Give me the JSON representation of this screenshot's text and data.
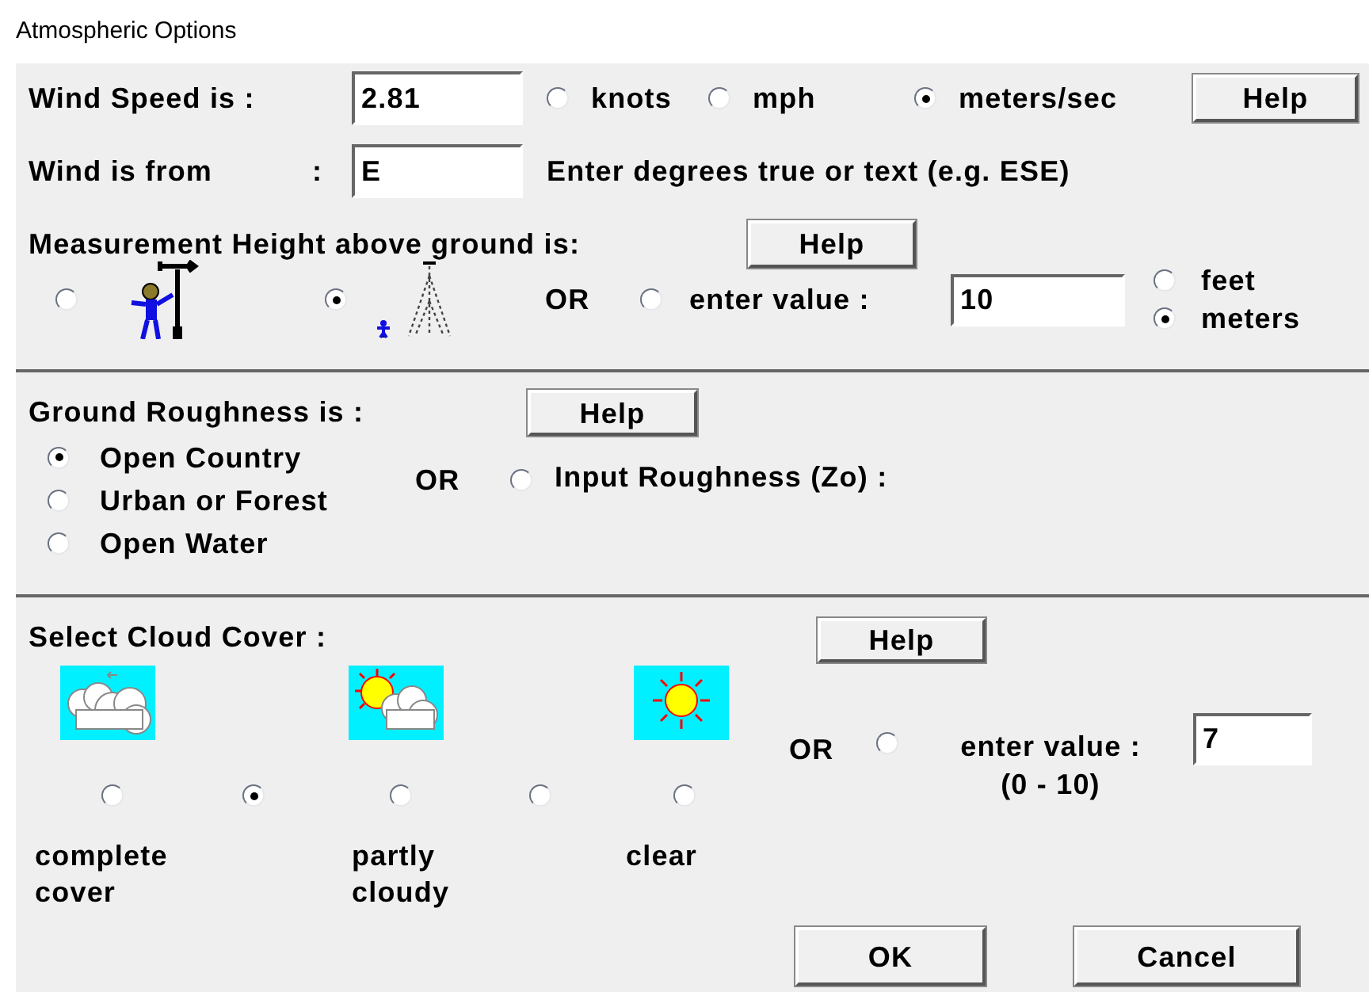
{
  "window": {
    "title": "Atmospheric Options"
  },
  "wind_speed": {
    "label": "Wind Speed is :",
    "value": "2.81",
    "units": [
      {
        "label": "knots",
        "selected": false
      },
      {
        "label": "mph",
        "selected": false
      },
      {
        "label": "meters/sec",
        "selected": true
      }
    ],
    "help": "Help"
  },
  "wind_direction": {
    "label": "Wind is from",
    "colon": ":",
    "value": "E",
    "hint": "Enter degrees true or text (e.g. ESE)"
  },
  "measurement_height": {
    "label": "Measurement Height above ground is:",
    "help": "Help",
    "options": [
      {
        "kind": "person",
        "selected": false
      },
      {
        "kind": "tower",
        "selected": true
      }
    ],
    "or": "OR",
    "custom": {
      "label": "enter value :",
      "selected": false,
      "value": "10"
    },
    "units": [
      {
        "label": "feet",
        "selected": false
      },
      {
        "label": "meters",
        "selected": true
      }
    ]
  },
  "ground_roughness": {
    "label": "Ground Roughness is :",
    "help": "Help",
    "options": [
      {
        "label": "Open Country",
        "selected": true
      },
      {
        "label": "Urban or Forest",
        "selected": false
      },
      {
        "label": "Open Water",
        "selected": false
      }
    ],
    "or": "OR",
    "custom": {
      "label": "Input Roughness (Zo) :",
      "selected": false
    }
  },
  "cloud_cover": {
    "label": "Select Cloud Cover :",
    "help": "Help",
    "icons": [
      {
        "kind": "overcast"
      },
      {
        "kind": "partly"
      },
      {
        "kind": "clear"
      }
    ],
    "options": [
      {
        "selected": false
      },
      {
        "selected": true
      },
      {
        "selected": false
      },
      {
        "selected": false
      },
      {
        "selected": false
      }
    ],
    "captions": [
      "complete cover",
      "partly cloudy",
      "clear"
    ],
    "or": "OR",
    "custom": {
      "label": "enter value :",
      "range": "(0 - 10)",
      "selected": false,
      "value": "7"
    }
  },
  "buttons": [
    "OK",
    "Cancel"
  ]
}
